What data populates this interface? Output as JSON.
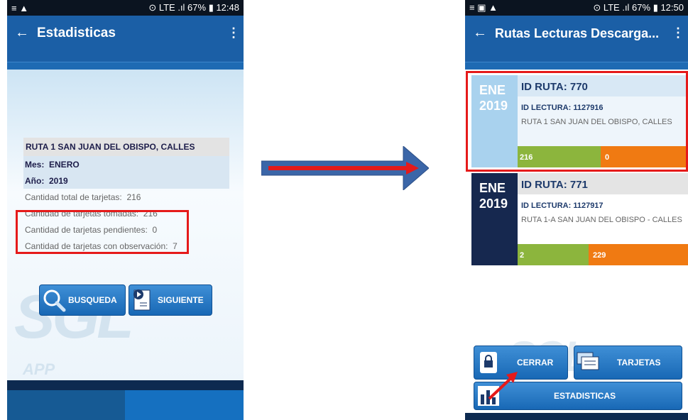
{
  "left": {
    "status": {
      "left_icons": "≡ ▲",
      "right": "⊙ LTE .ıl 67% ▮ 12:48"
    },
    "title": "Estadisticas",
    "route_name": "RUTA 1 SAN JUAN DEL OBISPO, CALLES",
    "mes_label": "Mes:",
    "mes_value": "ENERO",
    "anio_label": "Año:",
    "anio_value": "2019",
    "total_label": "Cantidad total de tarjetas:",
    "total_value": "216",
    "tomadas_label": "Cantidad de tarjetas tomadas:",
    "tomadas_value": "216",
    "pendientes_label": "Cantidad de tarjetas pendientes:",
    "pendientes_value": "0",
    "observacion_label": "Cantidad de tarjetas con observación:",
    "observacion_value": "7",
    "buttons": {
      "busqueda": "BUSQUEDA",
      "siguiente": "SIGUIENTE"
    },
    "watermark": "SGL",
    "watermark_sub": "APP"
  },
  "right": {
    "status": {
      "left_icons": "≡ ▣ ▲",
      "right": "⊙ LTE .ıl 67% ▮ 12:50"
    },
    "title": "Rutas Lecturas Descarga...",
    "routes": [
      {
        "month": "ENE",
        "year": "2019",
        "id_ruta": "ID RUTA: 770",
        "id_lectura": "ID LECTURA: 1127916",
        "desc": "RUTA 1 SAN JUAN DEL OBISPO, CALLES",
        "green": "216",
        "orange": "0"
      },
      {
        "month": "ENE",
        "year": "2019",
        "id_ruta": "ID RUTA: 771",
        "id_lectura": "ID LECTURA: 1127917",
        "desc": "RUTA 1-A SAN JUAN DEL OBISPO - CALLES",
        "green": "2",
        "orange": "229"
      }
    ],
    "buttons": {
      "cerrar": "CERRAR",
      "tarjetas": "TARJETAS",
      "estadisticas": "ESTADISTICAS"
    },
    "watermark": "SGL"
  },
  "colors": {
    "appbar": "#1b5fa6",
    "highlight": "#e51a1a",
    "green": "#8cb53d",
    "orange": "#f07a12",
    "card_selected": "#a9d2ee",
    "card_dark": "#16284f"
  }
}
